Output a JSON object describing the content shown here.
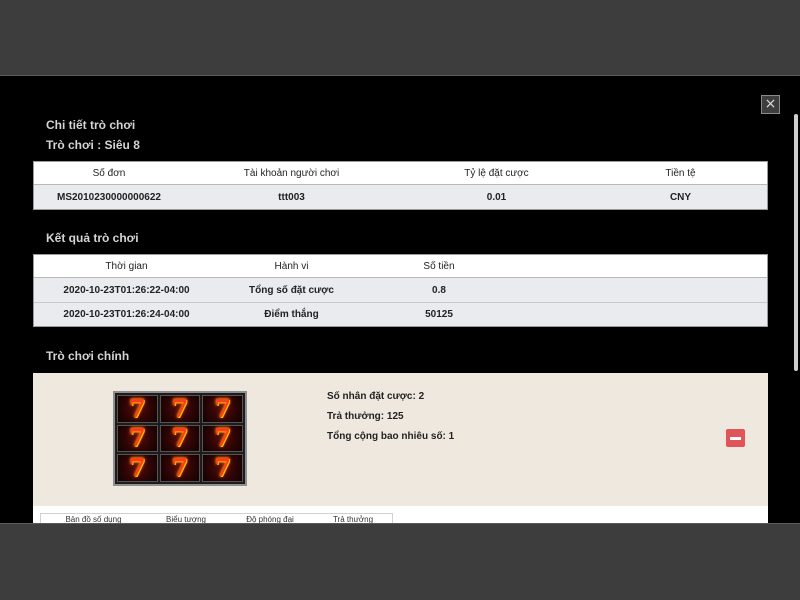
{
  "modal": {
    "close_label": "×",
    "title": "Chi tiết trò chơi",
    "game_name": "Trò chơi : Siêu 8"
  },
  "order_table": {
    "headers": [
      "Số đơn",
      "Tài khoản người chơi",
      "Tỷ lệ đặt cược",
      "Tiền tệ"
    ],
    "row": [
      "MS2010230000000622",
      "ttt003",
      "0.01",
      "CNY"
    ]
  },
  "result_section": {
    "title": "Kết quả trò chơi",
    "headers": [
      "Thời gian",
      "Hành vi",
      "Số tiền"
    ],
    "rows": [
      [
        "2020-10-23T01:26:22-04:00",
        "Tổng số đặt cược",
        "0.8"
      ],
      [
        "2020-10-23T01:26:24-04:00",
        "Điểm thắng",
        "50125"
      ]
    ]
  },
  "main_game": {
    "title": "Trò chơi chính",
    "reel_symbol": "7",
    "reels": [
      [
        "7",
        "7",
        "7"
      ],
      [
        "7",
        "7",
        "7"
      ],
      [
        "7",
        "7",
        "7"
      ]
    ],
    "bet_multiplier": "Số nhân đặt cược: 2",
    "payout": "Trả thưởng: 125",
    "total_count": "Tổng cộng bao nhiêu số: 1",
    "collapse_icon": "minus-icon",
    "collapse_color": "#e0545a"
  },
  "detail_table": {
    "headers": [
      "Bản đồ số dụng",
      "Biểu tượng",
      "Độ phóng đại",
      "Trả thưởng"
    ]
  }
}
